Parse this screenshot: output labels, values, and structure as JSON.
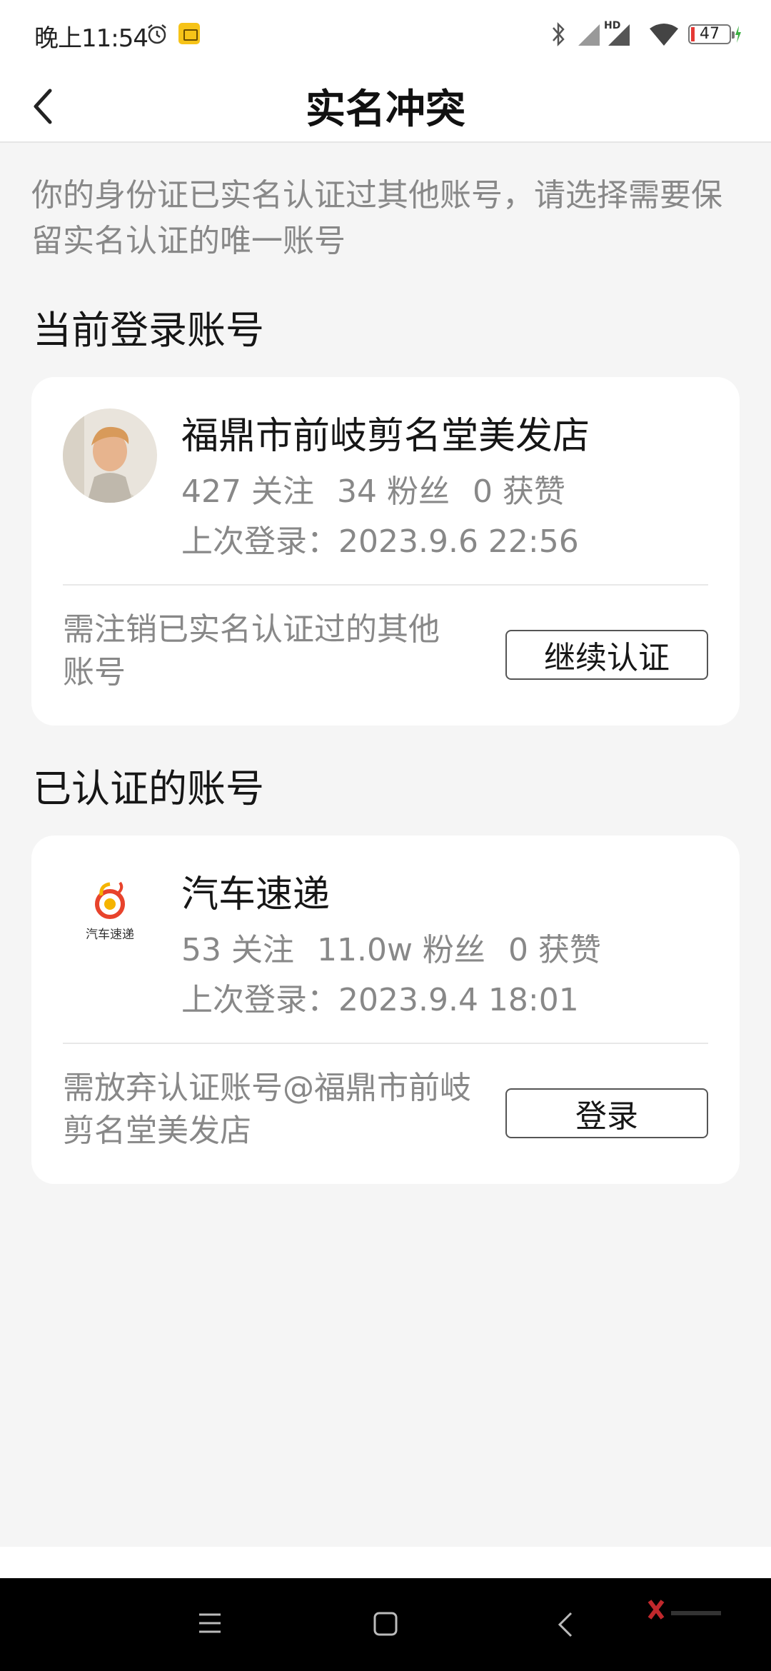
{
  "status_bar": {
    "time": "晚上11:54",
    "battery_level": "47",
    "icons": [
      "alarm-icon",
      "app-notification-icon",
      "bluetooth-icon",
      "signal-icon",
      "hd-signal-icon",
      "wifi-icon",
      "battery-icon"
    ],
    "battery_color": "#e53935"
  },
  "header": {
    "back_icon": "chevron-left-icon",
    "title": "实名冲突"
  },
  "notice": "你的身份证已实名认证过其他账号，请选择需要保留实名认证的唯一账号",
  "current_section": {
    "title": "当前登录账号",
    "account": {
      "name": "福鼎市前岐剪名堂美发店",
      "follows": "427 关注",
      "fans": "34 粉丝",
      "likes": "0 获赞",
      "last_login": "上次登录：2023.9.6 22:56"
    },
    "note": "需注销已实名认证过的其他账号",
    "button": "继续认证"
  },
  "verified_section": {
    "title": "已认证的账号",
    "account": {
      "name": "汽车速递",
      "follows": "53 关注",
      "fans": "11.0w 粉丝",
      "likes": "0 获赞",
      "last_login": "上次登录：2023.9.4 18:01",
      "logo_text": "汽车速递"
    },
    "note": "需放弃认证账号@福鼎市前岐剪名堂美发店",
    "button": "登录"
  },
  "nav_bar": {
    "icons": [
      "menu-icon",
      "home-icon",
      "back-icon"
    ]
  }
}
